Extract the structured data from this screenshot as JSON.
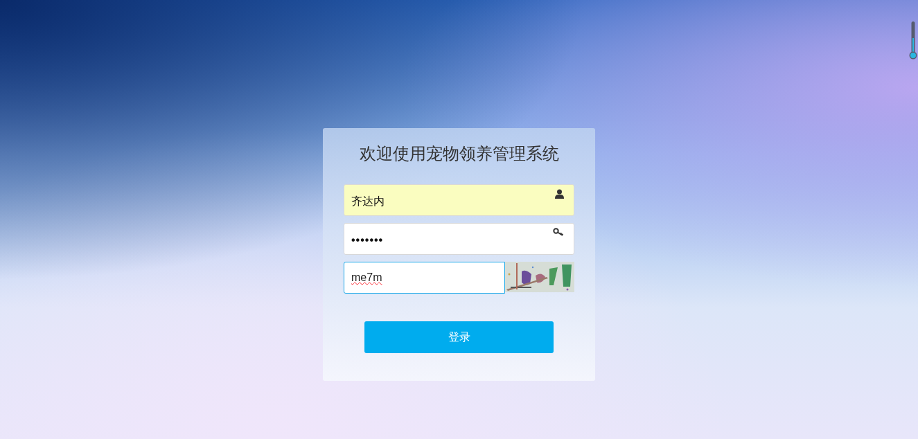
{
  "login_form": {
    "title": "欢迎使用宠物领养管理系统",
    "fields": [
      {
        "kind": "username",
        "value": "齐达内",
        "autofilled": true
      },
      {
        "kind": "password",
        "value": "•••••••",
        "autofilled": false
      },
      {
        "kind": "captcha",
        "value": "me7m",
        "focused": true
      }
    ],
    "submit": "登录"
  }
}
